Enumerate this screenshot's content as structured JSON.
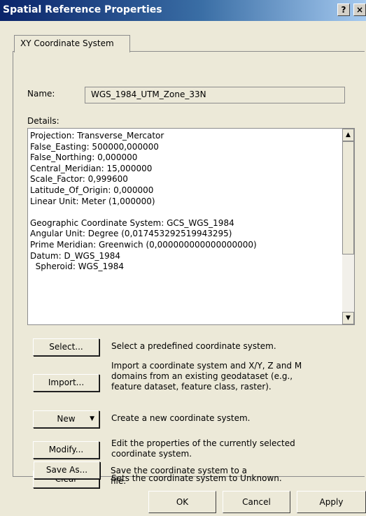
{
  "window": {
    "title": "Spatial Reference Properties",
    "help_label": "?",
    "close_label": "×"
  },
  "tabs": [
    {
      "label": "XY Coordinate System"
    }
  ],
  "name_label": "Name:",
  "name_value": "WGS_1984_UTM_Zone_33N",
  "details_label": "Details:",
  "details_lines": [
    "Projection: Transverse_Mercator",
    "False_Easting: 500000,000000",
    "False_Northing: 0,000000",
    "Central_Meridian: 15,000000",
    "Scale_Factor: 0,999600",
    "Latitude_Of_Origin: 0,000000",
    "Linear Unit: Meter (1,000000)",
    "",
    "Geographic Coordinate System: GCS_WGS_1984",
    "Angular Unit: Degree (0,017453292519943295)",
    "Prime Meridian: Greenwich (0,000000000000000000)",
    "Datum: D_WGS_1984",
    "  Spheroid: WGS_1984"
  ],
  "actions": {
    "select": {
      "label": "Select...",
      "desc": "Select a predefined coordinate system."
    },
    "import": {
      "label": "Import...",
      "desc": "Import a coordinate system and X/Y, Z and M domains from an existing geodataset (e.g., feature dataset, feature class, raster)."
    },
    "new": {
      "label": "New",
      "desc": "Create a new coordinate system."
    },
    "modify": {
      "label": "Modify...",
      "desc": "Edit the properties of the currently selected coordinate system."
    },
    "clear": {
      "label": "Clear",
      "desc": "Sets the coordinate system to Unknown."
    },
    "saveas": {
      "label": "Save As...",
      "desc": "Save the coordinate system to a file."
    }
  },
  "footer": {
    "ok": "OK",
    "cancel": "Cancel",
    "apply": "Apply"
  }
}
